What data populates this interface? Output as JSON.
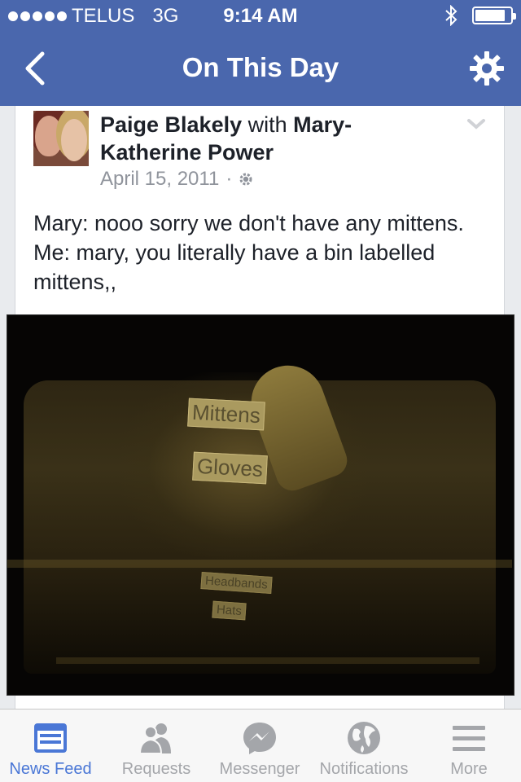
{
  "status_bar": {
    "carrier": "TELUS",
    "network": "3G",
    "time": "9:14 AM"
  },
  "nav": {
    "title": "On This Day",
    "back_icon": "chevron-left-icon",
    "settings_icon": "gear-icon"
  },
  "post": {
    "author": "Paige Blakely",
    "with_word": "with",
    "tagged": "Mary-Katherine Power",
    "date": "April 15, 2011",
    "separator": "·",
    "body": "Mary: nooo sorry we don't have any mittens. Me: mary, you literally have a bin labelled mittens,,",
    "photo_labels": {
      "mittens": "Mittens",
      "gloves": "Gloves",
      "headbands": "Headbands",
      "hats": "Hats"
    }
  },
  "tabs": [
    {
      "label": "News Feed",
      "icon": "news-feed-icon",
      "active": true
    },
    {
      "label": "Requests",
      "icon": "friends-icon",
      "active": false
    },
    {
      "label": "Messenger",
      "icon": "messenger-icon",
      "active": false
    },
    {
      "label": "Notifications",
      "icon": "globe-icon",
      "active": false
    },
    {
      "label": "More",
      "icon": "menu-icon",
      "active": false
    }
  ],
  "colors": {
    "brand": "#4a67ad",
    "active_tab": "#4a77d6",
    "inactive_tab": "#a4a6aa"
  }
}
